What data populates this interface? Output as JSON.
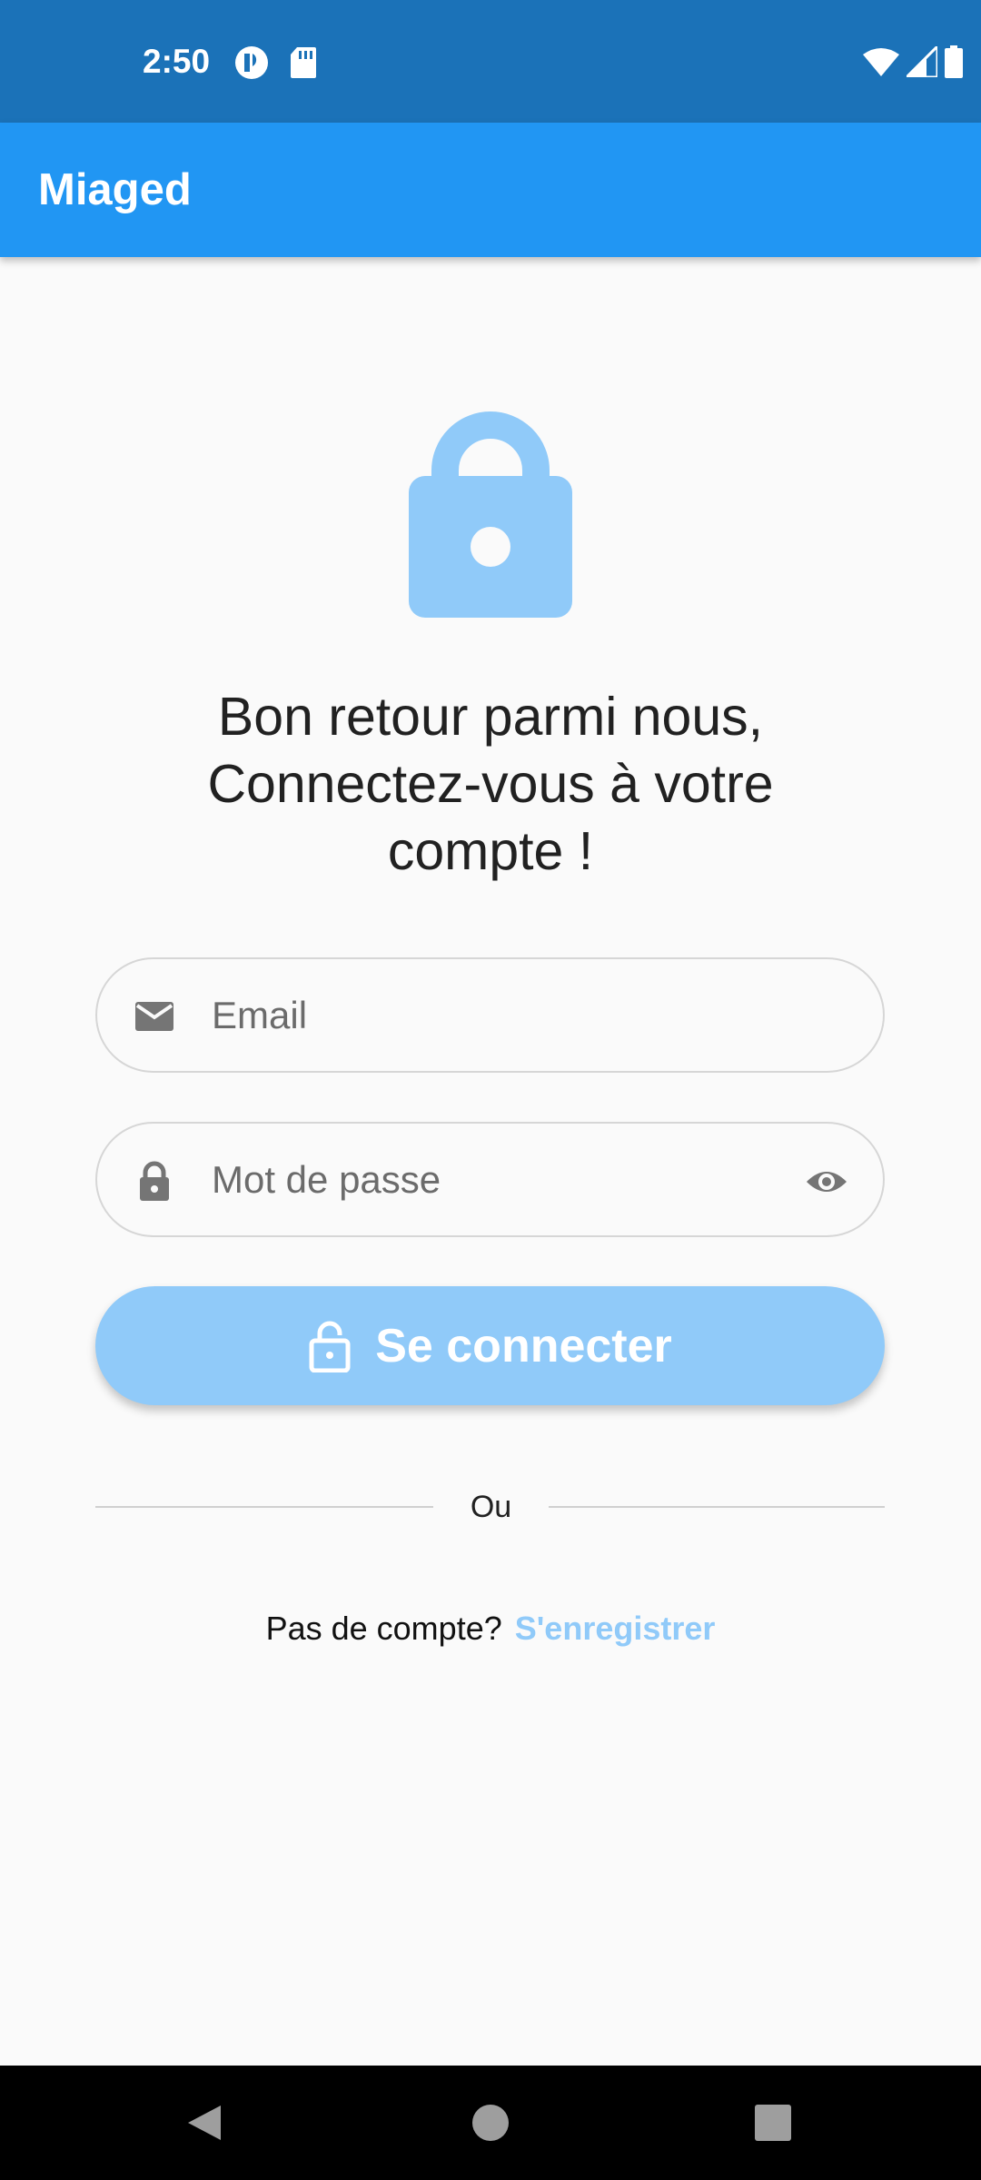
{
  "status_bar": {
    "time": "2:50",
    "icons": [
      "app-notification-icon",
      "sd-card-icon",
      "wifi-icon",
      "signal-icon",
      "battery-icon"
    ]
  },
  "app_bar": {
    "title": "Miaged"
  },
  "hero": {
    "icon": "lock-icon",
    "welcome_line1": "Bon retour parmi nous,",
    "welcome_line2": "Connectez-vous à votre",
    "welcome_line3": "compte !"
  },
  "form": {
    "email_placeholder": "Email",
    "email_icon": "email-icon",
    "password_placeholder": "Mot de passe",
    "password_icon": "lock-icon",
    "password_toggle_icon": "eye-icon",
    "login_label": "Se connecter",
    "login_icon": "lock-open-icon"
  },
  "divider": {
    "text": "Ou"
  },
  "register": {
    "prompt": "Pas de compte?",
    "link": "S'enregistrer"
  },
  "colors": {
    "status_bar": "#1b72b8",
    "app_bar": "#2196f3",
    "accent_light": "#90caf9",
    "background": "#fafafa"
  },
  "nav_bar": {
    "buttons": [
      "back-icon",
      "home-icon",
      "recents-icon"
    ]
  }
}
